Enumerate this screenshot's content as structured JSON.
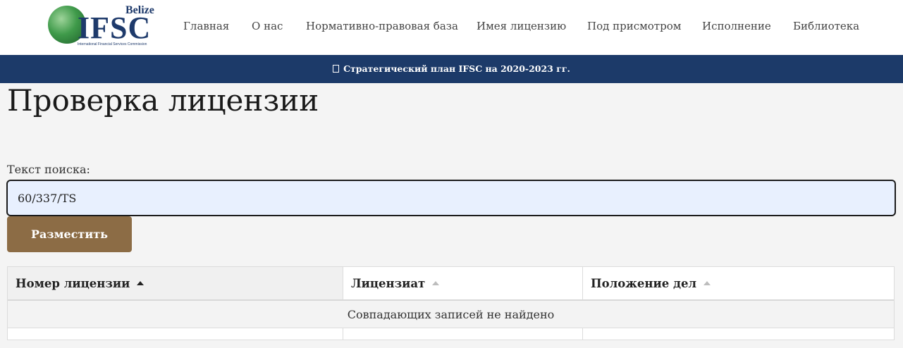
{
  "header": {
    "logo": {
      "top_text": "Belize",
      "main_text": "IFSC",
      "sub_text": "International Financial Services Commission"
    },
    "nav": [
      {
        "label": "Главная"
      },
      {
        "label": "О нас"
      },
      {
        "label": "Нормативно-правовая база"
      },
      {
        "label": "Имея лицензию"
      },
      {
        "label": "Под присмотром"
      },
      {
        "label": "Исполнение"
      },
      {
        "label": "Библиотека"
      }
    ]
  },
  "banner": {
    "icon": "document-icon",
    "text": "Стратегический план IFSC на 2020-2023 гг."
  },
  "main": {
    "title": "Проверка лицензии",
    "search": {
      "label": "Текст поиска:",
      "value": "60/337/TS"
    },
    "submit_label": "Разместить",
    "table": {
      "columns": [
        {
          "label": "Номер лицензии",
          "sort": "ascending"
        },
        {
          "label": "Лицензиат",
          "sort": "none"
        },
        {
          "label": "Положение дел",
          "sort": "none"
        }
      ],
      "empty_message": "Совпадающих записей не найдено"
    }
  },
  "colors": {
    "banner": "#1c3a69",
    "button": "#8c6c45",
    "input_bg": "#e8f0fe",
    "brand": "#1e3a6b"
  }
}
